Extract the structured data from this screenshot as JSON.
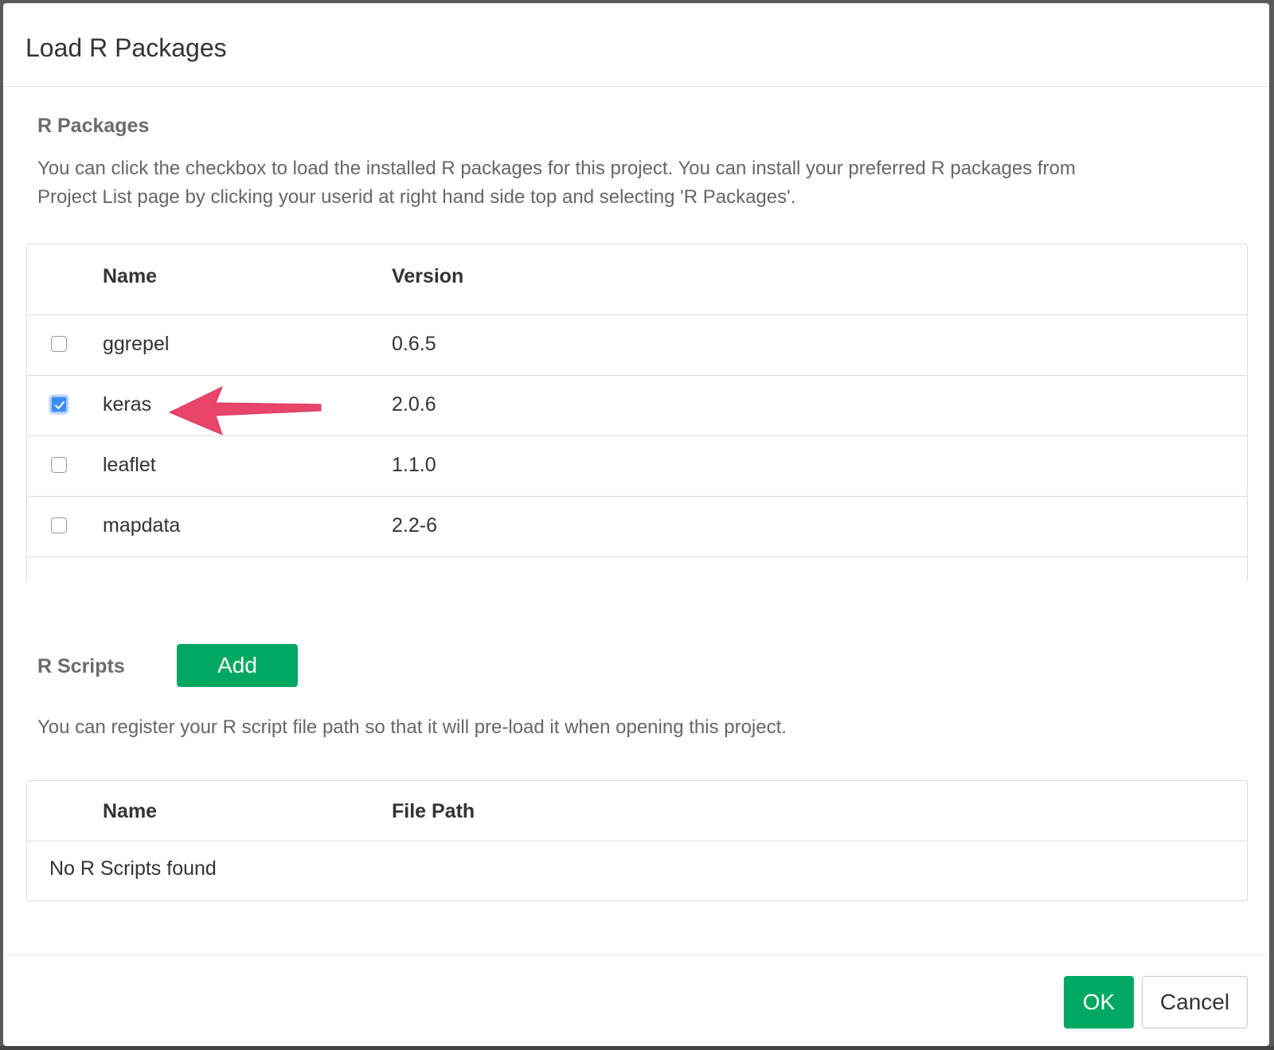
{
  "dialog": {
    "title": "Load R Packages"
  },
  "packages_section": {
    "title": "R Packages",
    "description_line1": "You can click the checkbox to load the installed R packages for this project. You can install your preferred R packages from",
    "description_line2": "Project List page by clicking your userid at right hand side top and selecting 'R Packages'.",
    "columns": [
      "Name",
      "Version"
    ],
    "rows": [
      {
        "name": "ggrepel",
        "version": "0.6.5",
        "checked": false
      },
      {
        "name": "keras",
        "version": "2.0.6",
        "checked": true
      },
      {
        "name": "leaflet",
        "version": "1.1.0",
        "checked": false
      },
      {
        "name": "mapdata",
        "version": "2.2-6",
        "checked": false
      }
    ]
  },
  "scripts_section": {
    "title": "R Scripts",
    "add_label": "Add",
    "description": "You can register your R script file path so that it will pre-load it when opening this project.",
    "columns": [
      "Name",
      "File Path"
    ],
    "empty_text": "No R Scripts found"
  },
  "footer": {
    "ok_label": "OK",
    "cancel_label": "Cancel"
  },
  "colors": {
    "accent_green": "#00a862",
    "checkbox_blue": "#3d8cf5",
    "annotation_arrow": "#e9446a"
  }
}
